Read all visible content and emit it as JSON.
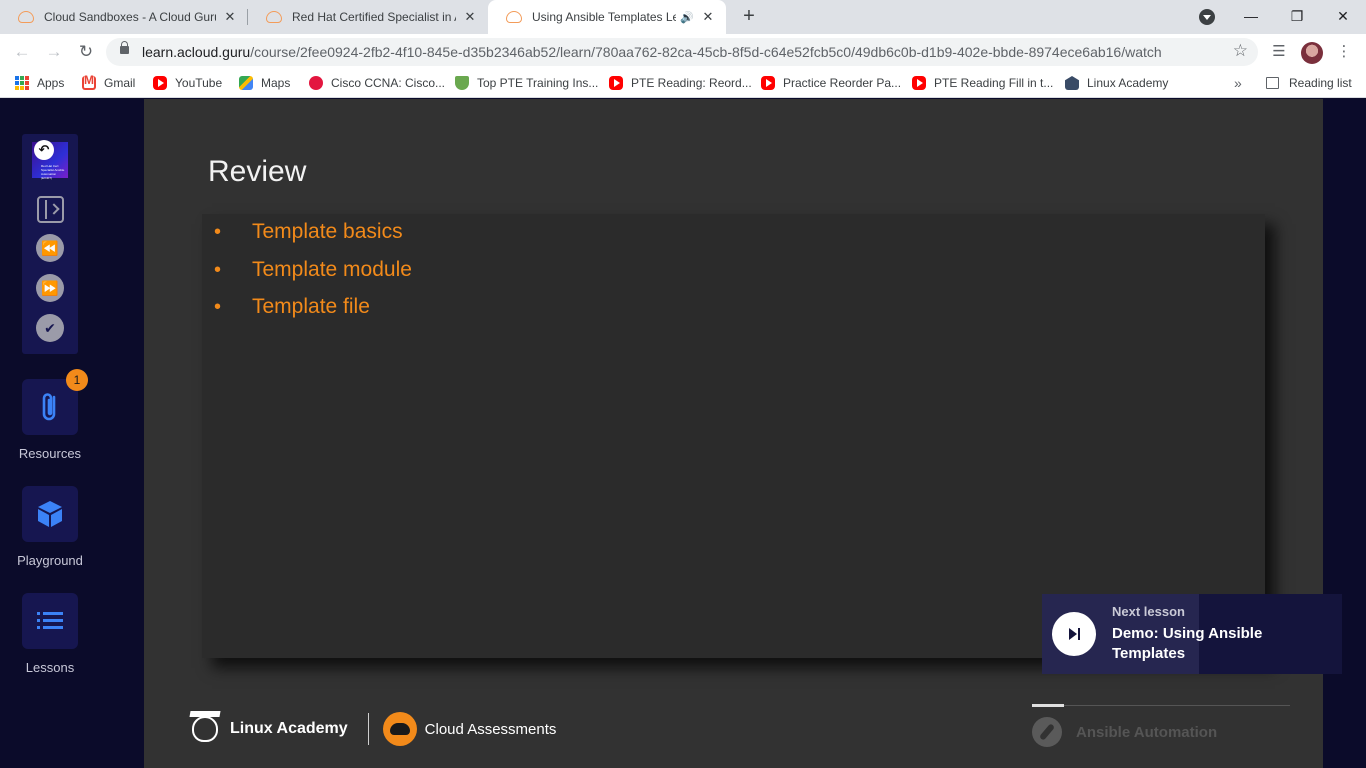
{
  "browser": {
    "tabs": [
      {
        "title": "Cloud Sandboxes - A Cloud Guru"
      },
      {
        "title": "Red Hat Certified Specialist in An"
      },
      {
        "title": "Using Ansible Templates Lec"
      }
    ],
    "close_glyph": "✕",
    "new_tab_glyph": "+",
    "url_host": "learn.acloud.guru",
    "url_path": "/course/2fee0924-2fb2-4f10-845e-d35b2346ab52/learn/780aa762-82ca-45cb-8f5d-c64e52fcb5c0/49db6c0b-d1b9-402e-bbde-8974ece6ab16/watch"
  },
  "bookmarks": {
    "items": [
      {
        "label": "Apps",
        "icon": "apps-grid-icon"
      },
      {
        "label": "Gmail",
        "icon": "gmail-icon"
      },
      {
        "label": "YouTube",
        "icon": "youtube-icon"
      },
      {
        "label": "Maps",
        "icon": "maps-icon"
      },
      {
        "label": "Cisco CCNA: Cisco...",
        "icon": "cisco-icon"
      },
      {
        "label": "Top PTE Training Ins...",
        "icon": "pte-icon"
      },
      {
        "label": "PTE Reading: Reord...",
        "icon": "youtube-icon"
      },
      {
        "label": "Practice Reorder Pa...",
        "icon": "youtube-icon"
      },
      {
        "label": "PTE Reading Fill in t...",
        "icon": "youtube-icon"
      },
      {
        "label": "Linux Academy",
        "icon": "linux-academy-icon"
      }
    ],
    "more_glyph": "»",
    "reading_list": "Reading list"
  },
  "sidebar": {
    "resources_label": "Resources",
    "resources_badge": "1",
    "playground_label": "Playground",
    "lessons_label": "Lessons",
    "thumbnail_text": "Red Hat Cert Specialist Ansible Automation (EX407)"
  },
  "slide": {
    "title": "Review",
    "bullets": [
      "Template basics",
      "Template module",
      "Template file"
    ],
    "footer_left": "Linux Academy",
    "footer_right": "Cloud Assessments",
    "brand": "Ansible Automation"
  },
  "next_lesson": {
    "label": "Next lesson",
    "title": "Demo: Using Ansible Templates"
  },
  "colors": {
    "accent": "#f28a1a",
    "sidebar_bg": "#0b0b2a",
    "panel_bg": "#161650"
  }
}
